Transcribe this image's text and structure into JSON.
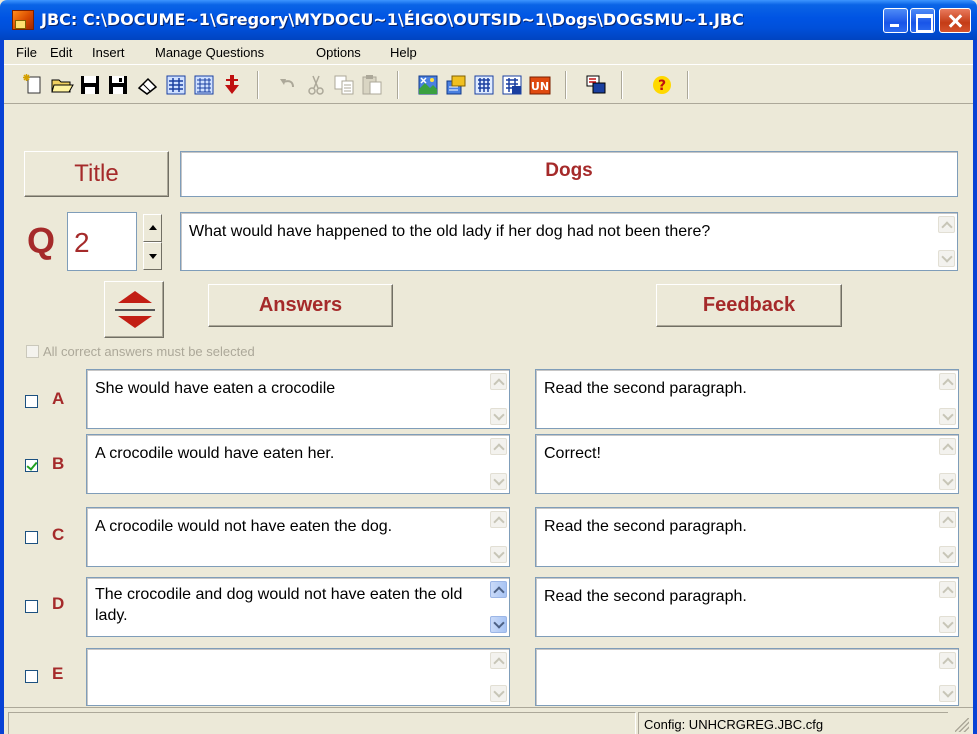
{
  "window": {
    "title": "JBC: C:\\DOCUME~1\\Gregory\\MYDOCU~1\\ÉIGO\\OUTSID~1\\Dogs\\DOGSMU~1.JBC"
  },
  "menu": {
    "file": "File",
    "edit": "Edit",
    "insert": "Insert",
    "manage_questions": "Manage Questions",
    "options": "Options",
    "help": "Help"
  },
  "toolbar": {
    "icons": [
      "new-file-icon",
      "open-folder-icon",
      "save-icon",
      "save-as-icon",
      "eraser-icon",
      "web-page-icon",
      "web-page-alt-icon",
      "arrow-down-icon",
      "undo-icon",
      "cut-icon",
      "copy-icon",
      "paste-icon",
      "add-picture-icon",
      "add-link-icon",
      "config-icon",
      "font-icon",
      "unicode-icon",
      "export-icon",
      "help-icon"
    ]
  },
  "title_section": {
    "label": "Title",
    "value": "Dogs"
  },
  "question": {
    "letter": "Q",
    "number": "2",
    "text": "What would have happened to the old lady if her dog had not been there?"
  },
  "headers": {
    "answers": "Answers",
    "feedback": "Feedback"
  },
  "all_correct_label": "All correct answers must be selected",
  "answers": [
    {
      "letter": "A",
      "answer": "She would have eaten a crocodile",
      "feedback": "Read the second paragraph.",
      "correct": false
    },
    {
      "letter": "B",
      "answer": "A crocodile would have eaten her.",
      "feedback": "Correct!",
      "correct": true
    },
    {
      "letter": "C",
      "answer": "A crocodile would not have eaten the dog.",
      "feedback": "Read the second paragraph.",
      "correct": false
    },
    {
      "letter": "D",
      "answer": "The crocodile and dog would not have eaten the old lady.",
      "feedback": "Read the second paragraph.",
      "correct": false
    },
    {
      "letter": "E",
      "answer": "",
      "feedback": "",
      "correct": false
    }
  ],
  "status": {
    "config": "Config: UNHCRGREG.JBC.cfg"
  },
  "colors": {
    "accent_red": "#a52a2a",
    "titlebar_blue": "#0054e3",
    "face": "#ece9d8"
  }
}
